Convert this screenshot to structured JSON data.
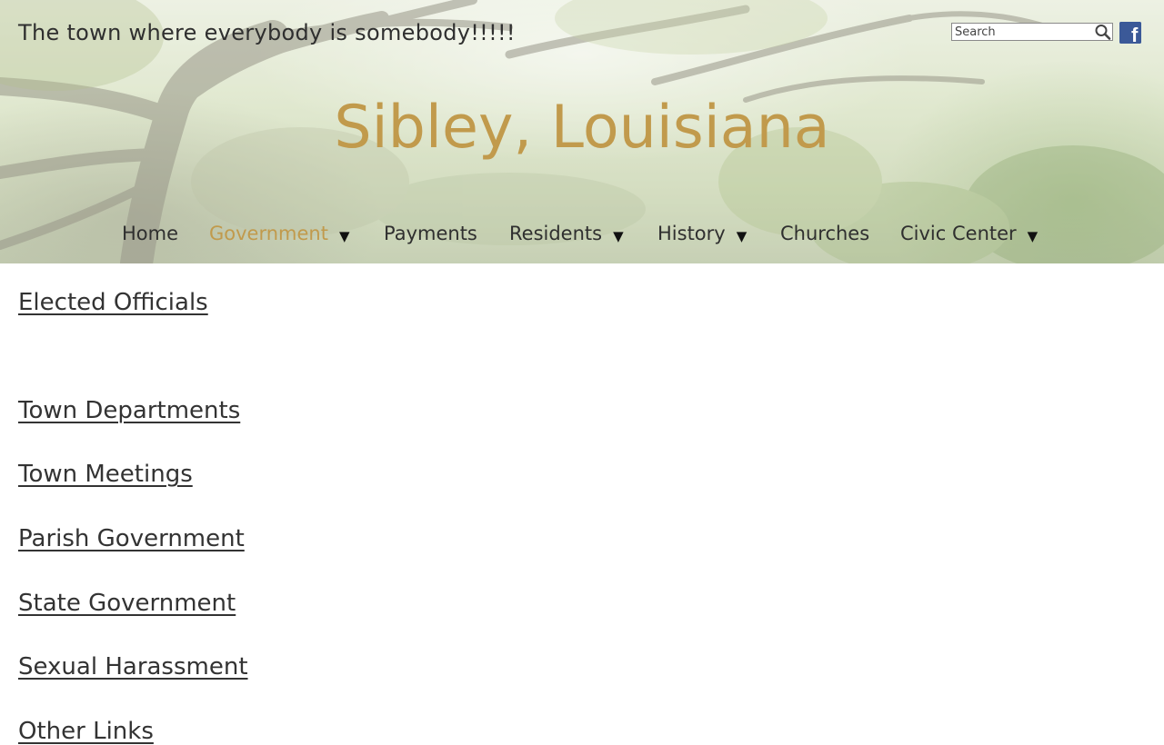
{
  "header": {
    "tagline": "The town where everybody is somebody!!!!!",
    "site_title": "Sibley, Louisiana",
    "search": {
      "placeholder": "Search",
      "value": ""
    },
    "social": {
      "facebook_glyph": "f"
    }
  },
  "nav": {
    "items": [
      {
        "label": "Home",
        "has_dropdown": false,
        "active": false
      },
      {
        "label": "Government",
        "has_dropdown": true,
        "active": true
      },
      {
        "label": "Payments",
        "has_dropdown": false,
        "active": false
      },
      {
        "label": "Residents",
        "has_dropdown": true,
        "active": false
      },
      {
        "label": "History",
        "has_dropdown": true,
        "active": false
      },
      {
        "label": "Churches",
        "has_dropdown": false,
        "active": false
      },
      {
        "label": "Civic Center",
        "has_dropdown": true,
        "active": false
      }
    ],
    "dropdown_arrow": "▼"
  },
  "main": {
    "links": [
      "Elected Officials",
      "Town Departments",
      "Town Meetings",
      "Parish Government",
      "State Government",
      "Sexual Harassment",
      "Other Links"
    ]
  },
  "colors": {
    "accent": "#c19a4c",
    "text": "#333333",
    "facebook": "#3b5998"
  },
  "icons": {
    "search": "search-icon",
    "facebook": "facebook-icon",
    "dropdown": "caret-down-icon"
  }
}
